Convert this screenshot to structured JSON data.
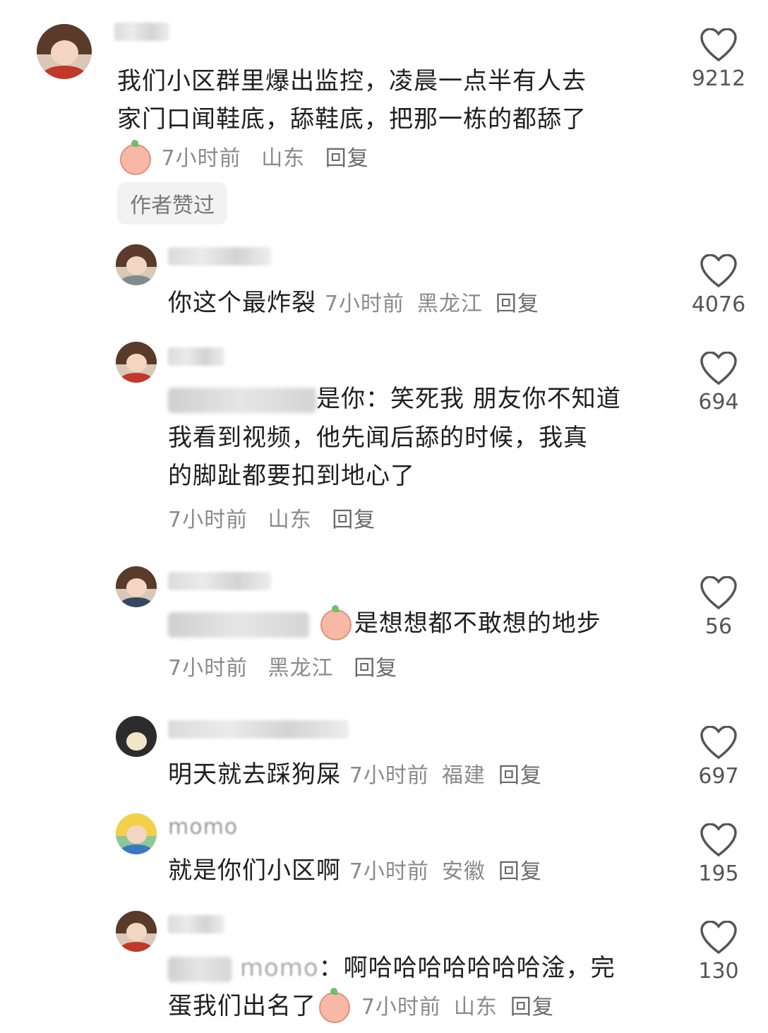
{
  "comments": [
    {
      "text_lines": [
        "我们小区群里爆出监控，凌晨一点半有人去",
        "家门口闻鞋底，舔鞋底，把那一栋的都舔了"
      ],
      "time": "7小时前",
      "location": "山东",
      "reply_label": "回复",
      "badge": "作者赞过",
      "likes": "9212"
    },
    {
      "text": "你这个最炸裂",
      "time": "7小时前",
      "location": "黑龙江",
      "reply_label": "回复",
      "likes": "4076"
    },
    {
      "text_lines": [
        "是你：笑死我 朋友你不知道",
        "我看到视频，他先闻后舔的时候，我真",
        "的脚趾都要扣到地心了"
      ],
      "time": "7小时前",
      "location": "山东",
      "reply_label": "回复",
      "likes": "694"
    },
    {
      "text": "是想想都不敢想的地步",
      "time": "7小时前",
      "location": "黑龙江",
      "reply_label": "回复",
      "likes": "56"
    },
    {
      "text": "明天就去踩狗屎",
      "time": "7小时前",
      "location": "福建",
      "reply_label": "回复",
      "likes": "697"
    },
    {
      "username": "momo",
      "text": "就是你们小区啊",
      "time": "7小时前",
      "location": "安徽",
      "reply_label": "回复",
      "likes": "195"
    },
    {
      "reply_prefix": "momo",
      "text_lines": [
        "：啊哈哈哈哈哈哈哈淦，完",
        "蛋我们出名了"
      ],
      "time": "7小时前",
      "location": "山东",
      "reply_label": "回复",
      "likes": "130"
    }
  ],
  "colors": {
    "text": "#1f1f1f",
    "meta": "#8a8a8a",
    "badge_bg": "#f2f2f2"
  },
  "icons": {
    "like": "heart-outline-icon",
    "emoji": "peach-face-emoji-icon"
  }
}
